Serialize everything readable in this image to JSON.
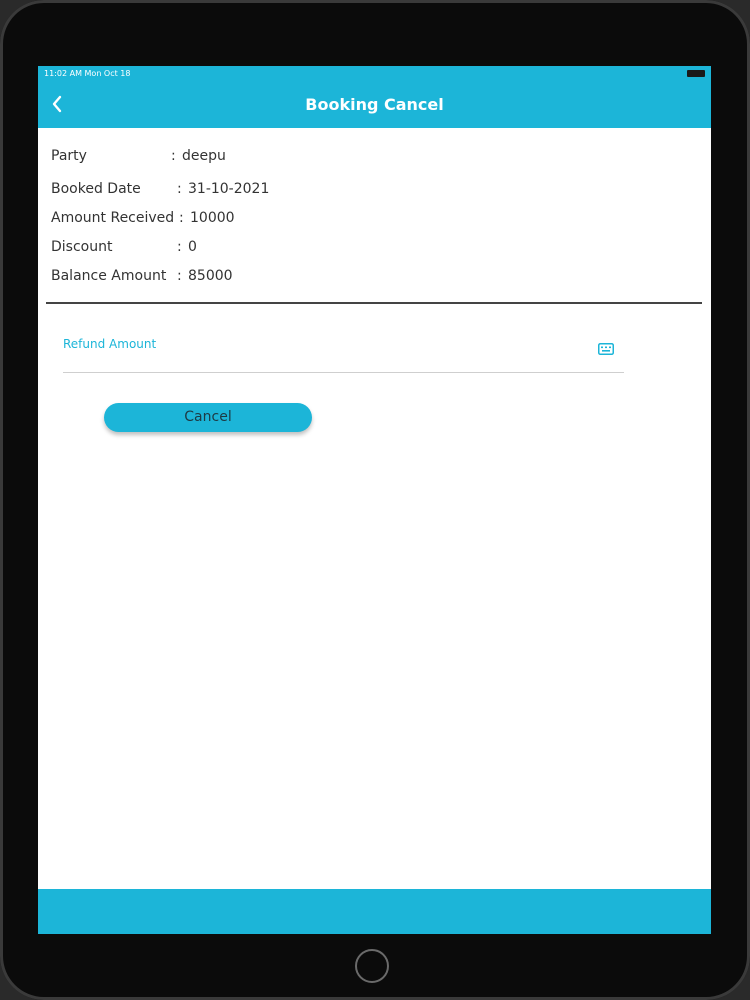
{
  "status_bar": {
    "time": "11:02 AM   Mon Oct 18"
  },
  "header": {
    "back_icon": "chevron-left-icon",
    "title": "Booking Cancel"
  },
  "details": [
    {
      "label": "Party",
      "separator": ":",
      "value": "deepu"
    },
    {
      "label": "Booked Date",
      "separator": ":",
      "value": "31-10-2021"
    },
    {
      "label": "Amount Received",
      "separator": ":",
      "value": "10000"
    },
    {
      "label": "Discount",
      "separator": ":",
      "value": "0"
    },
    {
      "label": "Balance Amount",
      "separator": ":",
      "value": "85000"
    }
  ],
  "refund_field": {
    "placeholder": "Refund Amount",
    "value": "",
    "icon": "keyboard-icon"
  },
  "cancel_button": {
    "label": "Cancel"
  },
  "colors": {
    "accent": "#1cb5d8",
    "text": "#333333",
    "device_frame": "#0b0b0b"
  }
}
